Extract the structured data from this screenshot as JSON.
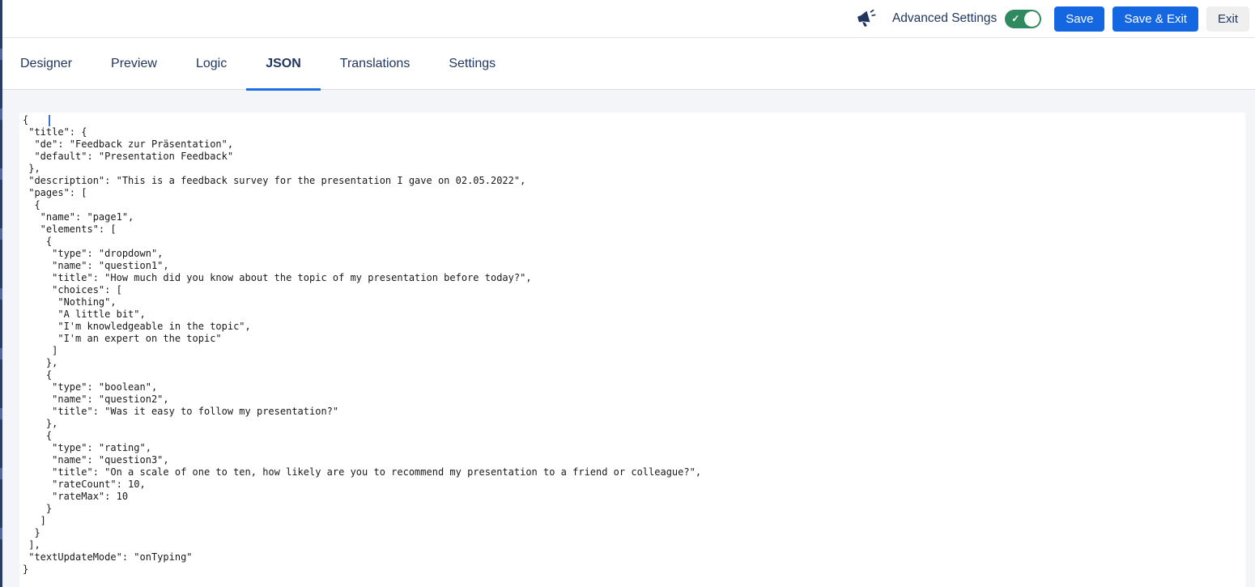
{
  "header": {
    "megaphone_icon": "megaphone-icon",
    "advanced_settings_label": "Advanced Settings",
    "advanced_settings_toggle": "on",
    "buttons": {
      "save": "Save",
      "save_and_exit": "Save & Exit",
      "exit": "Exit"
    }
  },
  "tabs": [
    {
      "label": "Designer",
      "active": false
    },
    {
      "label": "Preview",
      "active": false
    },
    {
      "label": "Logic",
      "active": false
    },
    {
      "label": "JSON",
      "active": true
    },
    {
      "label": "Translations",
      "active": false
    },
    {
      "label": "Settings",
      "active": false
    }
  ],
  "editor": {
    "language": "json",
    "code_lines": [
      "{",
      " \"title\": {",
      "  \"de\": \"Feedback zur Präsentation\",",
      "  \"default\": \"Presentation Feedback\"",
      " },",
      " \"description\": \"This is a feedback survey for the presentation I gave on 02.05.2022\",",
      " \"pages\": [",
      "  {",
      "   \"name\": \"page1\",",
      "   \"elements\": [",
      "    {",
      "     \"type\": \"dropdown\",",
      "     \"name\": \"question1\",",
      "     \"title\": \"How much did you know about the topic of my presentation before today?\",",
      "     \"choices\": [",
      "      \"Nothing\",",
      "      \"A little bit\",",
      "      \"I'm knowledgeable in the topic\",",
      "      \"I'm an expert on the topic\"",
      "     ]",
      "    },",
      "    {",
      "     \"type\": \"boolean\",",
      "     \"name\": \"question2\",",
      "     \"title\": \"Was it easy to follow my presentation?\"",
      "    },",
      "    {",
      "     \"type\": \"rating\",",
      "     \"name\": \"question3\",",
      "     \"title\": \"On a scale of one to ten, how likely are you to recommend my presentation to a friend or colleague?\",",
      "     \"rateCount\": 10,",
      "     \"rateMax\": 10",
      "    }",
      "   ]",
      "  }",
      " ],",
      " \"textUpdateMode\": \"onTyping\"",
      "}"
    ]
  },
  "colors": {
    "accent_blue": "#1467e0",
    "tab_underline_blue": "#1f6fe0",
    "toggle_green": "#2f8a60",
    "navy_text": "#21365f",
    "content_background": "#f4f5f8",
    "exit_button_background": "#efefef",
    "code_text": "#191919"
  }
}
